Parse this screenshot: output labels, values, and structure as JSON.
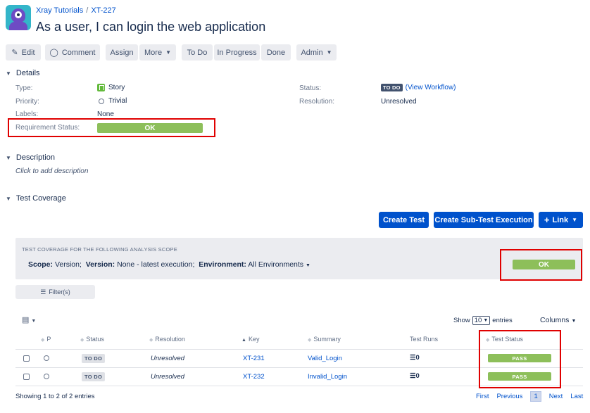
{
  "breadcrumb": {
    "project": "Xray Tutorials",
    "separator": "/",
    "issue_key": "XT-227"
  },
  "issue": {
    "title": "As a user, I can login the web application"
  },
  "toolbar": {
    "edit": "Edit",
    "comment": "Comment",
    "assign": "Assign",
    "more": "More",
    "todo": "To Do",
    "in_progress": "In Progress",
    "done": "Done",
    "admin": "Admin"
  },
  "details": {
    "heading": "Details",
    "type_label": "Type:",
    "type_value": "Story",
    "priority_label": "Priority:",
    "priority_value": "Trivial",
    "labels_label": "Labels:",
    "labels_value": "None",
    "req_status_label": "Requirement Status:",
    "req_status_value": "OK",
    "status_label": "Status:",
    "status_value": "TO DO",
    "workflow_link": "(View Workflow)",
    "resolution_label": "Resolution:",
    "resolution_value": "Unresolved"
  },
  "description": {
    "heading": "Description",
    "placeholder": "Click to add description"
  },
  "coverage": {
    "heading": "Test Coverage",
    "create_test": "Create Test",
    "create_sub": "Create Sub-Test Execution",
    "link": "Link",
    "scope_caption": "TEST COVERAGE FOR THE FOLLOWING ANALYSIS SCOPE",
    "scope_label": "Scope:",
    "scope_value": "Version;",
    "version_label": "Version:",
    "version_value": "None - latest execution;",
    "env_label": "Environment:",
    "env_value": "All Environments",
    "status": "OK",
    "filter": "Filter(s)"
  },
  "table": {
    "show_label": "Show",
    "show_value": "10",
    "entries_label": "entries",
    "columns_label": "Columns",
    "headers": [
      "P",
      "Status",
      "Resolution",
      "Key",
      "Summary",
      "Test Runs",
      "Test Status"
    ],
    "rows": [
      {
        "status": "TO DO",
        "resolution": "Unresolved",
        "key": "XT-231",
        "summary": "Valid_Login",
        "test_status": "PASS"
      },
      {
        "status": "TO DO",
        "resolution": "Unresolved",
        "key": "XT-232",
        "summary": "Invalid_Login",
        "test_status": "PASS"
      }
    ],
    "footer": "Showing 1 to 2 of 2 entries",
    "pager": {
      "first": "First",
      "previous": "Previous",
      "current": "1",
      "next": "Next",
      "last": "Last"
    }
  },
  "colors": {
    "accent": "#0052cc",
    "ok": "#8dbf5a",
    "highlight": "#e00000"
  }
}
